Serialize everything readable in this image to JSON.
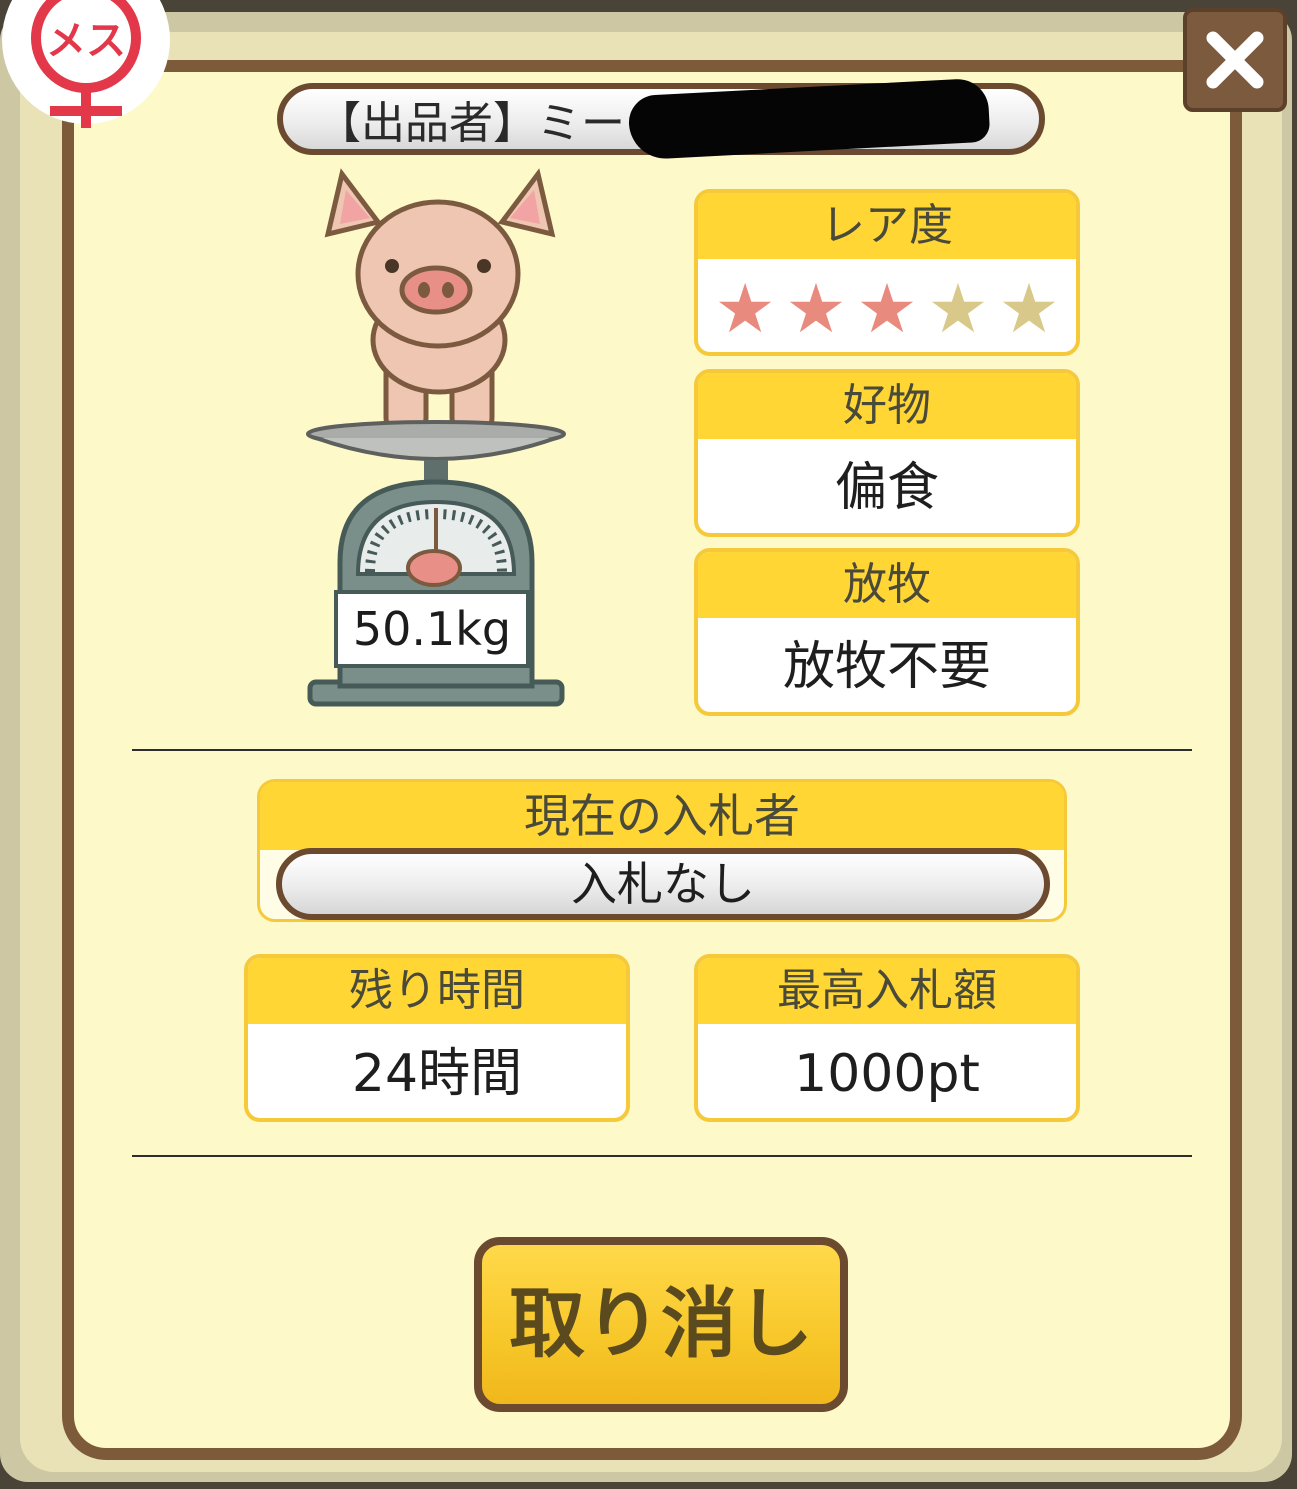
{
  "badge": {
    "gender_label": "メス",
    "icon": "female-symbol-icon"
  },
  "close_icon": "close-icon",
  "seller": {
    "label": "【出品者】ミー",
    "name_redacted": true
  },
  "pig": {
    "weight": "50.1kg",
    "icon": "pig-on-scale-icon"
  },
  "rarity": {
    "label": "レア度",
    "stars_total": 5,
    "stars_filled": 3,
    "filled_color": "#e88a7e",
    "empty_color": "#d8c98a"
  },
  "favorite": {
    "label": "好物",
    "value": "偏食"
  },
  "grazing": {
    "label": "放牧",
    "value": "放牧不要"
  },
  "current_bidder": {
    "label": "現在の入札者",
    "value": "入札なし"
  },
  "time_left": {
    "label": "残り時間",
    "value": "24時間"
  },
  "max_bid": {
    "label": "最高入札額",
    "value": "1000pt"
  },
  "cancel_button": {
    "label": "取り消し"
  },
  "colors": {
    "frame_brown": "#7d5a3a",
    "panel_bg": "#fdf9c8",
    "header_yellow": "#ffd634",
    "box_border": "#f5c93a"
  }
}
